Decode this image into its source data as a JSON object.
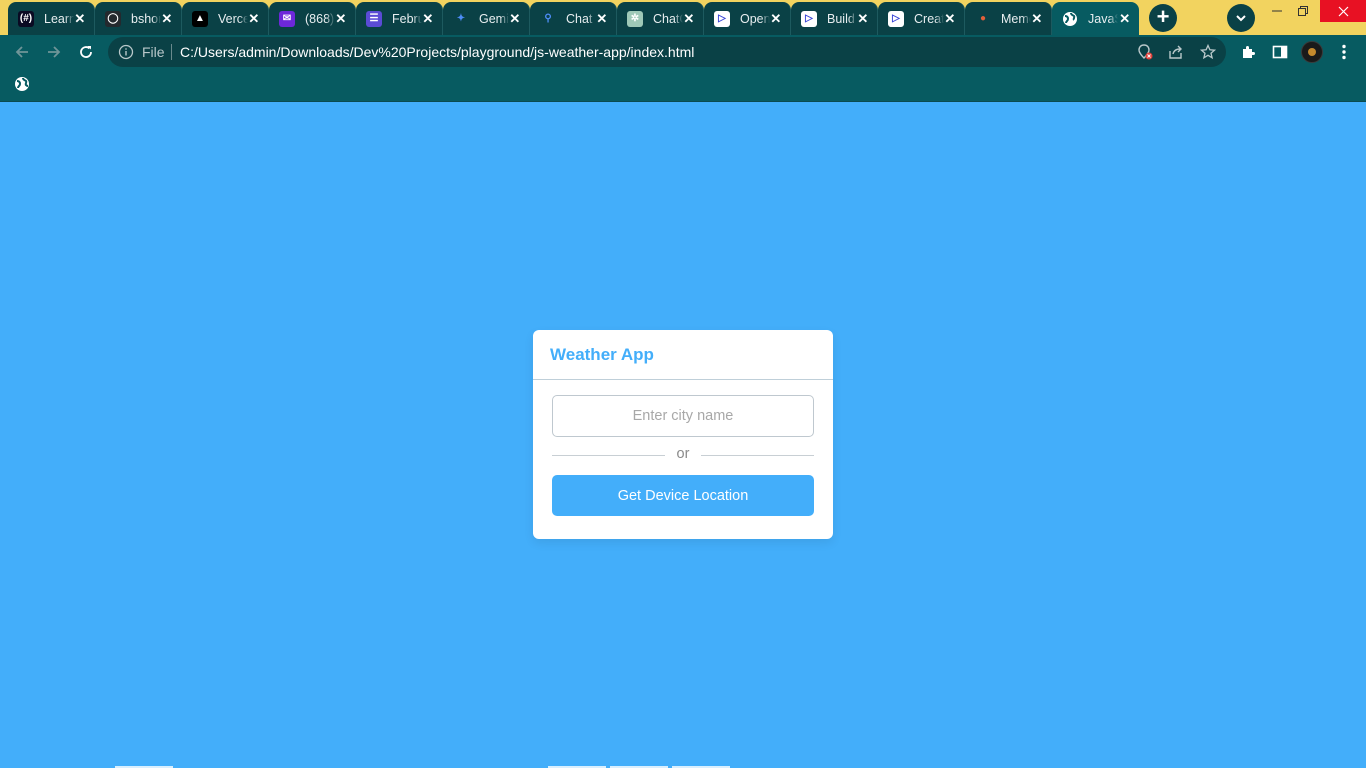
{
  "browser": {
    "tabs": [
      {
        "title": "Learn",
        "favicon": "freecodecamp-icon",
        "color": "#0a0a23",
        "glyph": "(#)"
      },
      {
        "title": "bshort",
        "favicon": "github-icon",
        "color": "#24292e",
        "glyph": "◯"
      },
      {
        "title": "Vercel",
        "favicon": "vercel-icon",
        "color": "#000000",
        "glyph": "▲"
      },
      {
        "title": "(868)",
        "favicon": "mail-icon",
        "color": "#6d28d9",
        "glyph": "✉"
      },
      {
        "title": "February",
        "favicon": "list-icon",
        "color": "#5b4bd5",
        "glyph": "☰"
      },
      {
        "title": "Gemini",
        "favicon": "gemini-icon",
        "color": "transparent",
        "glyph": "✦"
      },
      {
        "title": "Chat",
        "favicon": "search-icon",
        "color": "transparent",
        "glyph": "⚲"
      },
      {
        "title": "ChatGPT",
        "favicon": "openai-icon",
        "color": "#9fc9b8",
        "glyph": "✲"
      },
      {
        "title": "Open",
        "favicon": "play-icon",
        "color": "#ffffff",
        "glyph": "▷"
      },
      {
        "title": "Build",
        "favicon": "play-icon",
        "color": "#ffffff",
        "glyph": "▷"
      },
      {
        "title": "Create",
        "favicon": "play-icon",
        "color": "#ffffff",
        "glyph": "▷"
      },
      {
        "title": "Meme",
        "favicon": "helmet-icon",
        "color": "transparent",
        "glyph": "●"
      },
      {
        "title": "JavaScript",
        "favicon": "globe-icon",
        "color": "transparent",
        "glyph": "🌐",
        "active": true
      }
    ],
    "omnibox": {
      "scheme_label": "File",
      "url": "C:/Users/admin/Downloads/Dev%20Projects/playground/js-weather-app/index.html"
    },
    "colors": {
      "tabstrip": "#f2d35f",
      "toolbar": "#075b61",
      "page_background": "#43aefa"
    }
  },
  "weather_app": {
    "title": "Weather App",
    "city_placeholder": "Enter city name",
    "city_value": "",
    "divider_text": "or",
    "location_button": "Get Device Location",
    "accent_color": "#43aefa"
  }
}
